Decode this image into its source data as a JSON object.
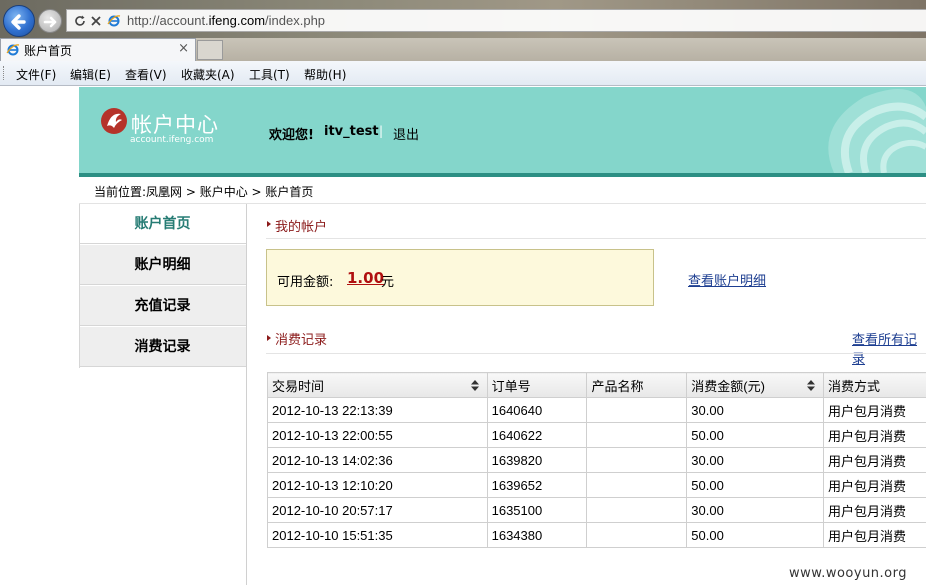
{
  "browser": {
    "url_prefix": "http://account.",
    "url_domain": "ifeng.com",
    "url_path": "/index.php",
    "tab_title": "账户首页",
    "tab_close": "×"
  },
  "menu": [
    {
      "label": "文件(F)"
    },
    {
      "label": "编辑(E)"
    },
    {
      "label": "查看(V)"
    },
    {
      "label": "收藏夹(A)"
    },
    {
      "label": "工具(T)"
    },
    {
      "label": "帮助(H)"
    }
  ],
  "header": {
    "logo_title": "帐户中心",
    "logo_sub": "account.ifeng.com",
    "welcome": "欢迎您!",
    "username": "itv_test",
    "separator": "|",
    "logout": "退出"
  },
  "breadcrumb": "当前位置:凤凰网 > 账户中心 > 账户首页",
  "sidebar": {
    "items": [
      {
        "label": "账户首页",
        "active": true
      },
      {
        "label": "账户明细",
        "active": false
      },
      {
        "label": "充值记录",
        "active": false
      },
      {
        "label": "消费记录",
        "active": false
      }
    ]
  },
  "account": {
    "section_title": "我的帐户",
    "balance_label": "可用金额:",
    "balance_value": "1.00",
    "balance_unit": "元",
    "detail_link": "查看账户明细"
  },
  "consumption": {
    "section_title": "消费记录",
    "all_link": "查看所有记录",
    "columns": [
      "交易时间",
      "订单号",
      "产品名称",
      "消费金额(元)",
      "消费方式"
    ],
    "rows": [
      [
        "2012-10-13 22:13:39",
        "1640640",
        "",
        "30.00",
        "用户包月消费"
      ],
      [
        "2012-10-13 22:00:55",
        "1640622",
        "",
        "50.00",
        "用户包月消费"
      ],
      [
        "2012-10-13 14:02:36",
        "1639820",
        "",
        "30.00",
        "用户包月消费"
      ],
      [
        "2012-10-13 12:10:20",
        "1639652",
        "",
        "50.00",
        "用户包月消费"
      ],
      [
        "2012-10-10 20:57:17",
        "1635100",
        "",
        "30.00",
        "用户包月消费"
      ],
      [
        "2012-10-10 15:51:35",
        "1634380",
        "",
        "50.00",
        "用户包月消费"
      ]
    ]
  },
  "watermark": "www.wooyun.org",
  "colors": {
    "header_bg": "#84d6cb",
    "accent": "#267c74",
    "section_title": "#8b1a1a",
    "balance_value": "#b01010",
    "link": "#1d3e91"
  }
}
